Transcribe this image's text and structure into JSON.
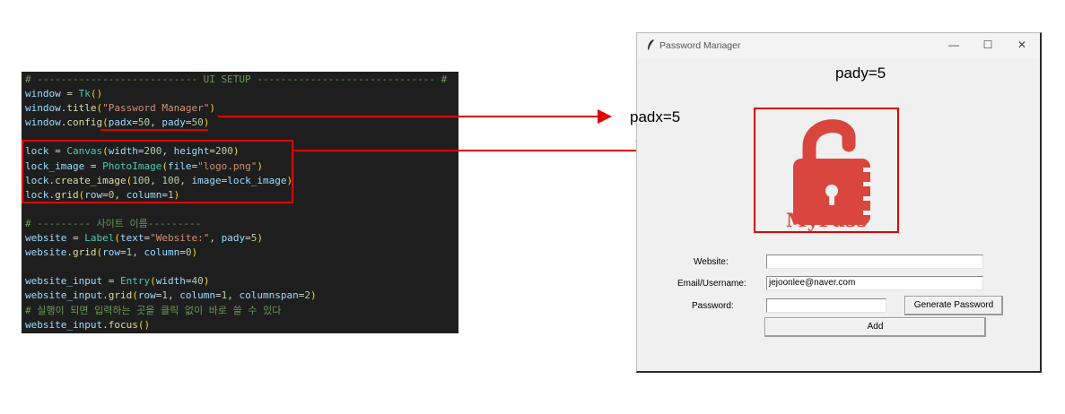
{
  "code": {
    "lines": [
      [
        {
          "t": "# --------------------------- UI SETUP ------------------------------ #",
          "c": "c"
        }
      ],
      [
        {
          "t": "window",
          "c": "v"
        },
        {
          "t": " = ",
          "c": "p"
        },
        {
          "t": "Tk",
          "c": "cl"
        },
        {
          "t": "()",
          "c": "pr"
        }
      ],
      [
        {
          "t": "window",
          "c": "v"
        },
        {
          "t": ".",
          "c": "p"
        },
        {
          "t": "title",
          "c": "f"
        },
        {
          "t": "(",
          "c": "pr"
        },
        {
          "t": "\"Password Manager\"",
          "c": "s"
        },
        {
          "t": ")",
          "c": "pr"
        }
      ],
      [
        {
          "t": "window",
          "c": "v"
        },
        {
          "t": ".",
          "c": "p"
        },
        {
          "t": "config",
          "c": "f"
        },
        {
          "t": "(",
          "c": "pr"
        },
        {
          "t": "padx",
          "c": "v"
        },
        {
          "t": "=",
          "c": "p"
        },
        {
          "t": "50",
          "c": "n"
        },
        {
          "t": ", ",
          "c": "p"
        },
        {
          "t": "pady",
          "c": "v"
        },
        {
          "t": "=",
          "c": "p"
        },
        {
          "t": "50",
          "c": "n"
        },
        {
          "t": ")",
          "c": "pr"
        }
      ],
      [],
      [
        {
          "t": "lock",
          "c": "v"
        },
        {
          "t": " = ",
          "c": "p"
        },
        {
          "t": "Canvas",
          "c": "cl"
        },
        {
          "t": "(",
          "c": "pr"
        },
        {
          "t": "width",
          "c": "v"
        },
        {
          "t": "=",
          "c": "p"
        },
        {
          "t": "200",
          "c": "n"
        },
        {
          "t": ", ",
          "c": "p"
        },
        {
          "t": "height",
          "c": "v"
        },
        {
          "t": "=",
          "c": "p"
        },
        {
          "t": "200",
          "c": "n"
        },
        {
          "t": ")",
          "c": "pr"
        }
      ],
      [
        {
          "t": "lock_image",
          "c": "v"
        },
        {
          "t": " = ",
          "c": "p"
        },
        {
          "t": "PhotoImage",
          "c": "cl"
        },
        {
          "t": "(",
          "c": "pr"
        },
        {
          "t": "file",
          "c": "v"
        },
        {
          "t": "=",
          "c": "p"
        },
        {
          "t": "\"logo.png\"",
          "c": "s"
        },
        {
          "t": ")",
          "c": "pr"
        }
      ],
      [
        {
          "t": "lock",
          "c": "v"
        },
        {
          "t": ".",
          "c": "p"
        },
        {
          "t": "create_image",
          "c": "f"
        },
        {
          "t": "(",
          "c": "pr"
        },
        {
          "t": "100",
          "c": "n"
        },
        {
          "t": ", ",
          "c": "p"
        },
        {
          "t": "100",
          "c": "n"
        },
        {
          "t": ", ",
          "c": "p"
        },
        {
          "t": "image",
          "c": "v"
        },
        {
          "t": "=",
          "c": "p"
        },
        {
          "t": "lock_image",
          "c": "v"
        },
        {
          "t": ")",
          "c": "pr"
        }
      ],
      [
        {
          "t": "lock",
          "c": "v"
        },
        {
          "t": ".",
          "c": "p"
        },
        {
          "t": "grid",
          "c": "f"
        },
        {
          "t": "(",
          "c": "pr"
        },
        {
          "t": "row",
          "c": "v"
        },
        {
          "t": "=",
          "c": "p"
        },
        {
          "t": "0",
          "c": "n"
        },
        {
          "t": ", ",
          "c": "p"
        },
        {
          "t": "column",
          "c": "v"
        },
        {
          "t": "=",
          "c": "p"
        },
        {
          "t": "1",
          "c": "n"
        },
        {
          "t": ")",
          "c": "pr"
        }
      ],
      [],
      [
        {
          "t": "# --------- 사이트 이름---------",
          "c": "c"
        }
      ],
      [
        {
          "t": "website",
          "c": "v"
        },
        {
          "t": " = ",
          "c": "p"
        },
        {
          "t": "Label",
          "c": "cl"
        },
        {
          "t": "(",
          "c": "pr"
        },
        {
          "t": "text",
          "c": "v"
        },
        {
          "t": "=",
          "c": "p"
        },
        {
          "t": "\"Website:\"",
          "c": "s"
        },
        {
          "t": ", ",
          "c": "p"
        },
        {
          "t": "pady",
          "c": "v"
        },
        {
          "t": "=",
          "c": "p"
        },
        {
          "t": "5",
          "c": "n"
        },
        {
          "t": ")",
          "c": "pr"
        }
      ],
      [
        {
          "t": "website",
          "c": "v"
        },
        {
          "t": ".",
          "c": "p"
        },
        {
          "t": "grid",
          "c": "f"
        },
        {
          "t": "(",
          "c": "pr"
        },
        {
          "t": "row",
          "c": "v"
        },
        {
          "t": "=",
          "c": "p"
        },
        {
          "t": "1",
          "c": "n"
        },
        {
          "t": ", ",
          "c": "p"
        },
        {
          "t": "column",
          "c": "v"
        },
        {
          "t": "=",
          "c": "p"
        },
        {
          "t": "0",
          "c": "n"
        },
        {
          "t": ")",
          "c": "pr"
        }
      ],
      [],
      [
        {
          "t": "website_input",
          "c": "v"
        },
        {
          "t": " = ",
          "c": "p"
        },
        {
          "t": "Entry",
          "c": "cl"
        },
        {
          "t": "(",
          "c": "pr"
        },
        {
          "t": "width",
          "c": "v"
        },
        {
          "t": "=",
          "c": "p"
        },
        {
          "t": "40",
          "c": "n"
        },
        {
          "t": ")",
          "c": "pr"
        }
      ],
      [
        {
          "t": "website_input",
          "c": "v"
        },
        {
          "t": ".",
          "c": "p"
        },
        {
          "t": "grid",
          "c": "f"
        },
        {
          "t": "(",
          "c": "pr"
        },
        {
          "t": "row",
          "c": "v"
        },
        {
          "t": "=",
          "c": "p"
        },
        {
          "t": "1",
          "c": "n"
        },
        {
          "t": ", ",
          "c": "p"
        },
        {
          "t": "column",
          "c": "v"
        },
        {
          "t": "=",
          "c": "p"
        },
        {
          "t": "1",
          "c": "n"
        },
        {
          "t": ", ",
          "c": "p"
        },
        {
          "t": "columnspan",
          "c": "v"
        },
        {
          "t": "=",
          "c": "p"
        },
        {
          "t": "2",
          "c": "n"
        },
        {
          "t": ")",
          "c": "pr"
        }
      ],
      [
        {
          "t": "# 실행이 되면 입력하는 곳을 클릭 없이 바로 쓸 수 있다",
          "c": "c"
        }
      ],
      [
        {
          "t": "website_input",
          "c": "v"
        },
        {
          "t": ".",
          "c": "p"
        },
        {
          "t": "focus",
          "c": "f"
        },
        {
          "t": "()",
          "c": "pr"
        }
      ]
    ]
  },
  "annotations": {
    "pady_label": "pady=5",
    "padx_label": "padx=5"
  },
  "window": {
    "title": "Password Manager",
    "minimize": "—",
    "maximize": "☐",
    "close": "✕",
    "logo_text": "MyPass",
    "website_label": "Website:",
    "website_value": "",
    "email_label": "Email/Username:",
    "email_value": "jejoonlee@naver.com",
    "password_label": "Password:",
    "password_value": "",
    "generate_button": "Generate Password",
    "add_button": "Add"
  },
  "colors": {
    "annotation_red": "#e00000",
    "annotation_blue": "#1f6fb8",
    "logo_red": "#d9463d"
  }
}
